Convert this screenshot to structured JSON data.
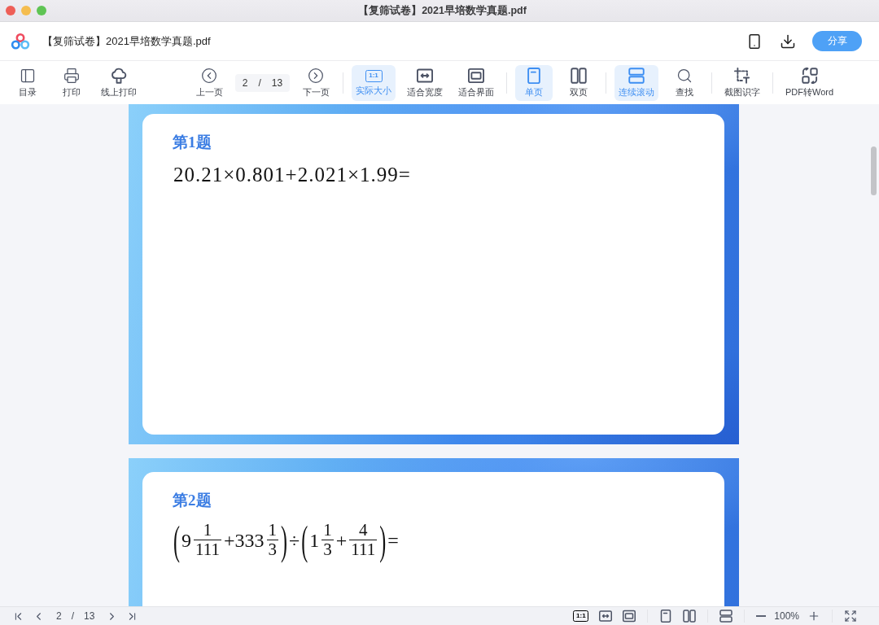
{
  "window": {
    "title": "【复筛试卷】2021早培数学真题.pdf"
  },
  "header": {
    "file_name": "【复筛试卷】2021早培数学真题.pdf",
    "share_button": "分享"
  },
  "toolbar": {
    "groups": [
      {
        "items": [
          {
            "kind": "button",
            "label": "目录",
            "selected": false
          },
          {
            "kind": "button",
            "label": "打印",
            "selected": false
          },
          {
            "kind": "button",
            "label": "线上打印",
            "selected": false
          }
        ]
      },
      {
        "items": [
          {
            "kind": "button",
            "label": "上一页",
            "selected": false
          },
          {
            "kind": "page_field",
            "value": "2",
            "separator": "/",
            "total": "13"
          },
          {
            "kind": "button",
            "label": "下一页",
            "selected": false
          }
        ]
      },
      {
        "items": [
          {
            "kind": "button",
            "label": "实际大小",
            "icon_text": "1:1",
            "selected": true
          },
          {
            "kind": "button",
            "label": "适合宽度",
            "selected": false
          },
          {
            "kind": "button",
            "label": "适合界面",
            "selected": false
          }
        ]
      },
      {
        "items": [
          {
            "kind": "button",
            "label": "单页",
            "selected": true
          },
          {
            "kind": "button",
            "label": "双页",
            "selected": false
          }
        ]
      },
      {
        "items": [
          {
            "kind": "button",
            "label": "连续滚动",
            "selected": true
          },
          {
            "kind": "button",
            "label": "查找",
            "selected": false
          }
        ]
      },
      {
        "items": [
          {
            "kind": "button",
            "label": "截图识字",
            "selected": false
          }
        ]
      },
      {
        "items": [
          {
            "kind": "button",
            "label": "PDF转Word",
            "selected": false
          }
        ]
      }
    ]
  },
  "pages": [
    {
      "question_title": "第1题",
      "formula": [
        {
          "kind": "text",
          "text": "20.21×0.801+2.021×1.99="
        }
      ]
    },
    {
      "question_title": "第2题",
      "formula": [
        {
          "kind": "bracket",
          "text": "("
        },
        {
          "kind": "text",
          "text": "9"
        },
        {
          "kind": "fraction",
          "numerator": "1",
          "denominator": "111"
        },
        {
          "kind": "text",
          "text": "+333"
        },
        {
          "kind": "fraction",
          "numerator": "1",
          "denominator": "3"
        },
        {
          "kind": "bracket",
          "text": ")"
        },
        {
          "kind": "text",
          "text": "÷"
        },
        {
          "kind": "bracket",
          "text": "("
        },
        {
          "kind": "text",
          "text": "1"
        },
        {
          "kind": "fraction",
          "numerator": "1",
          "denominator": "3"
        },
        {
          "kind": "text",
          "text": "+"
        },
        {
          "kind": "fraction",
          "numerator": "4",
          "denominator": "111"
        },
        {
          "kind": "bracket",
          "text": ")"
        },
        {
          "kind": "text",
          "text": "="
        }
      ]
    }
  ],
  "status_bar": {
    "page_current": "2",
    "page_separator": "/",
    "page_total": "13",
    "actual_size_icon_text": "1:1",
    "zoom": "100%"
  }
}
